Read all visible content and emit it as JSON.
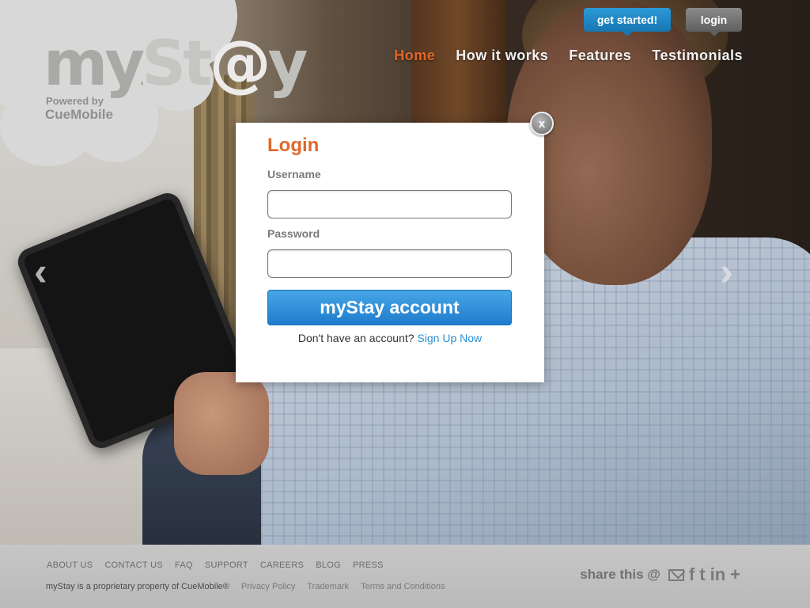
{
  "logo": {
    "my": "my",
    "st": "St",
    "at": "@",
    "y": "y",
    "powered": "Powered by",
    "brand": "CueMobile"
  },
  "top_buttons": {
    "get_started": "get started!",
    "login": "login"
  },
  "nav": [
    {
      "label": "Home",
      "active": true
    },
    {
      "label": "How it works",
      "active": false
    },
    {
      "label": "Features",
      "active": false
    },
    {
      "label": "Testimonials",
      "active": false
    }
  ],
  "carousel": {
    "prev": "‹",
    "next": "›"
  },
  "login_modal": {
    "title": "Login",
    "username_label": "Username",
    "username_value": "",
    "password_label": "Password",
    "password_value": "",
    "submit_label": "myStay account",
    "signup_prompt": "Don't have an account?",
    "signup_link": "Sign Up Now",
    "close_label": "x"
  },
  "footer": {
    "links": [
      "ABOUT US",
      "CONTACT US",
      "FAQ",
      "SUPPORT",
      "CAREERS",
      "BLOG",
      "PRESS"
    ],
    "copyright": "myStay is a proprietary property of CueMobile®",
    "legal": [
      "Privacy Policy",
      "Trademark",
      "Terms and Conditions"
    ],
    "share_label": "share this @",
    "share_icons": {
      "email": "email-icon",
      "facebook": "f",
      "twitter": "t",
      "linkedin": "in",
      "plus": "+"
    }
  },
  "colors": {
    "accent_orange": "#e0682a",
    "primary_blue": "#1e7ccc",
    "link_blue": "#2a8fd2"
  }
}
